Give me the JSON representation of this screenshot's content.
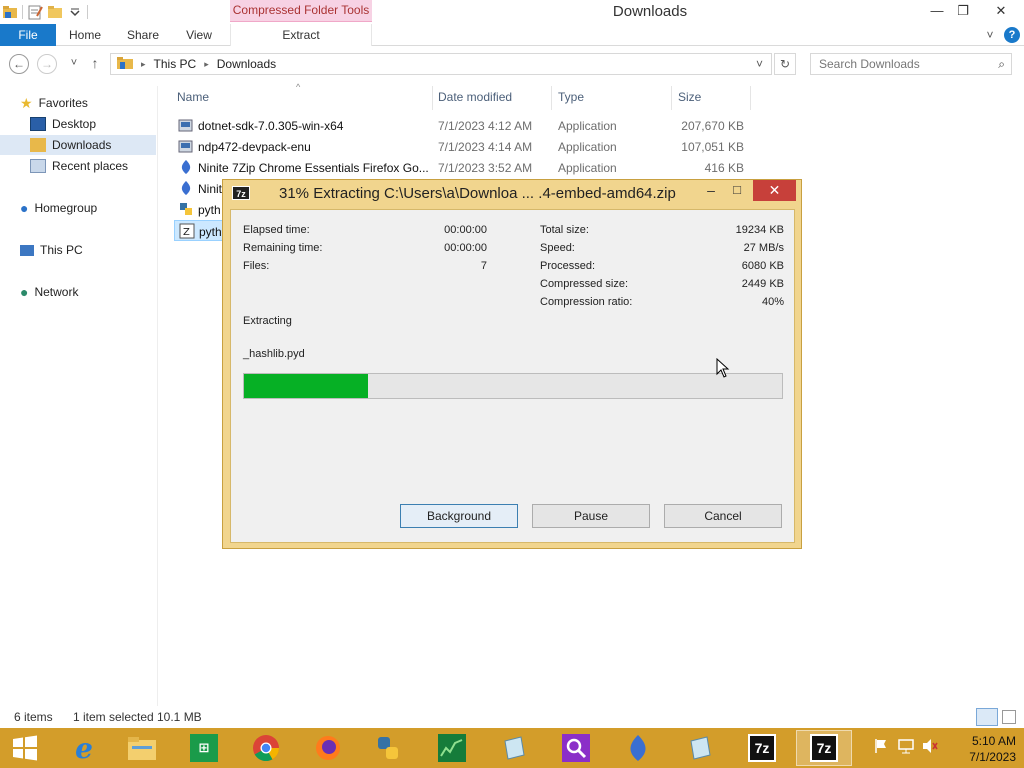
{
  "window": {
    "title": "Downloads",
    "context_tab_header": "Compressed Folder Tools",
    "controls": {
      "minimize": "—",
      "maximize": "❐",
      "close": "✕"
    }
  },
  "ribbon": {
    "tabs": [
      {
        "label": "File"
      },
      {
        "label": "Home"
      },
      {
        "label": "Share"
      },
      {
        "label": "View"
      },
      {
        "label": "Extract"
      }
    ],
    "collapse_glyph": "˅",
    "help_glyph": "?"
  },
  "address": {
    "back": "←",
    "forward": "→",
    "history": "˅",
    "up": "↑",
    "crumbs": [
      "This PC",
      "Downloads"
    ],
    "separator": "▸",
    "dropdown": "˅",
    "refresh": "↻",
    "search_placeholder": "Search Downloads",
    "search_glyph": "⌕"
  },
  "nav": {
    "favorites": "Favorites",
    "desktop": "Desktop",
    "downloads": "Downloads",
    "recent": "Recent places",
    "homegroup": "Homegroup",
    "thispc": "This PC",
    "network": "Network"
  },
  "columns": {
    "name": "Name",
    "date": "Date modified",
    "type": "Type",
    "size": "Size"
  },
  "files": [
    {
      "name": "dotnet-sdk-7.0.305-win-x64",
      "date": "7/1/2023 4:12 AM",
      "type": "Application",
      "size": "207,670 KB"
    },
    {
      "name": "ndp472-devpack-enu",
      "date": "7/1/2023 4:14 AM",
      "type": "Application",
      "size": "107,051 KB"
    },
    {
      "name": "Ninite 7Zip Chrome Essentials Firefox Go...",
      "date": "7/1/2023 3:52 AM",
      "type": "Application",
      "size": "416 KB"
    },
    {
      "name": "Ninit",
      "date": "",
      "type": "",
      "size": ""
    },
    {
      "name": "pyth",
      "date": "",
      "type": "",
      "size": ""
    },
    {
      "name": "pyth",
      "date": "",
      "type": "",
      "size": ""
    }
  ],
  "status": {
    "items": "6 items",
    "selected": "1 item selected",
    "selected_size": "10.1 MB"
  },
  "dialog": {
    "icon": "7z",
    "title": "31% Extracting C:\\Users\\a\\Downloa ... .4-embed-amd64.zip",
    "elapsed_label": "Elapsed time:",
    "elapsed_value": "00:00:00",
    "remaining_label": "Remaining time:",
    "remaining_value": "00:00:00",
    "files_label": "Files:",
    "files_value": "7",
    "total_label": "Total size:",
    "total_value": "19234 KB",
    "speed_label": "Speed:",
    "speed_value": "27 MB/s",
    "processed_label": "Processed:",
    "processed_value": "6080 KB",
    "compressed_label": "Compressed size:",
    "compressed_value": "2449 KB",
    "ratio_label": "Compression ratio:",
    "ratio_value": "40%",
    "status": "Extracting",
    "current_file": "_hashlib.pyd",
    "progress_percent": 23,
    "buttons": {
      "background": "Background",
      "pause": "Pause",
      "cancel": "Cancel"
    },
    "controls": {
      "minimize": "–",
      "maximize": "□",
      "close": "✕"
    }
  },
  "taskbar": {
    "clock_time": "5:10 AM",
    "clock_date": "7/1/2023",
    "sevenzip_label": "7z"
  }
}
